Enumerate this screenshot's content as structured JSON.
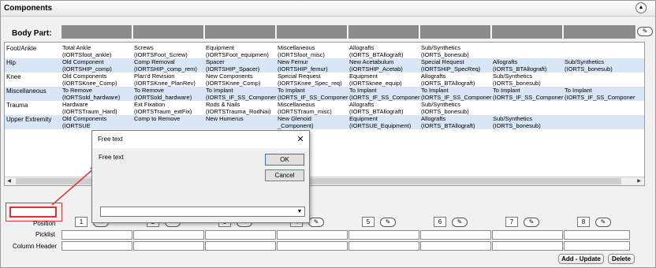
{
  "panel": {
    "title": "Components",
    "collapse_icon": "chevron-up-icon"
  },
  "body_part": {
    "label": "Body Part:",
    "edit_icon": "pencil-icon"
  },
  "grid": {
    "rows": [
      {
        "category": "Foot/Ankle",
        "cells": [
          {
            "name": "Total Ankle",
            "code": "(IORTSfoot_ankle)"
          },
          {
            "name": "Screws",
            "code": "(IORTSFoot_Screw)"
          },
          {
            "name": "Equipment",
            "code": "(IORTSFoot_equipmen)"
          },
          {
            "name": "Miscellaneous",
            "code": "(IORTSfoot_misc)"
          },
          {
            "name": "Allografts",
            "code": "(IORTS_BTAllograft)"
          },
          {
            "name": "Sub/Synthetics",
            "code": "(IORTS_bonesub)"
          },
          {
            "name": "",
            "code": ""
          },
          {
            "name": "",
            "code": ""
          }
        ]
      },
      {
        "category": "Hip",
        "cells": [
          {
            "name": "Old Component",
            "code": "(IORTSHIP_comp)"
          },
          {
            "name": "Comp Removal",
            "code": "(IORTSHIP_comp_rem)"
          },
          {
            "name": "Spacer",
            "code": "(IORTSHIP_Spacer)"
          },
          {
            "name": "New Femur",
            "code": "(IORTSHIP_femur)"
          },
          {
            "name": "New Acetabulum",
            "code": "(IORTSHIP_Acetab)"
          },
          {
            "name": "Special Request",
            "code": "(IORTSHIP_SpecReq)"
          },
          {
            "name": "Allografts",
            "code": "(IORTS_BTAllograft)"
          },
          {
            "name": "Sub/Synthetics",
            "code": "(IORTS_bonesub)"
          }
        ]
      },
      {
        "category": "Knee",
        "cells": [
          {
            "name": "Old Components",
            "code": "(IORTSKnee_Comp)"
          },
          {
            "name": "Plan'd Revision",
            "code": "(IORTSKnee_PlanRev)"
          },
          {
            "name": "New Components",
            "code": "(IORTSKnee_Comp)"
          },
          {
            "name": "Special Request",
            "code": "(IORTSKnee_Spec_req)"
          },
          {
            "name": "Equipment",
            "code": "(IORTSknee_equip)"
          },
          {
            "name": "Allografts",
            "code": "(IORTS_BTAllograft)"
          },
          {
            "name": "Sub/Synthetics",
            "code": "(IORTS_bonesub)"
          },
          {
            "name": "",
            "code": ""
          }
        ]
      },
      {
        "category": "Miscellaneous",
        "cells": [
          {
            "name": "To Remove",
            "code": "(IORTSold_hardware)"
          },
          {
            "name": "To Remove",
            "code": "(IORTSold_hardware)"
          },
          {
            "name": "To Implant",
            "code": "(IORTS_IF_SS_Componer"
          },
          {
            "name": "To Implant",
            "code": "(IORTS_IF_SS_Componer"
          },
          {
            "name": "To Implant",
            "code": "(IORTS_IF_SS_Componer"
          },
          {
            "name": "To Implant",
            "code": "(IORTS_IF_SS_Componer"
          },
          {
            "name": "To Implant",
            "code": "(IORTS_IF_SS_Componer"
          },
          {
            "name": "To Implant",
            "code": "(IORTS_IF_SS_Componer"
          }
        ]
      },
      {
        "category": "Trauma",
        "cells": [
          {
            "name": "Hardware",
            "code": "(IORTSTraum_Hard)"
          },
          {
            "name": "Ext Fixation",
            "code": "(IORTSTraum_extFix)"
          },
          {
            "name": "Rods & Nails",
            "code": "(IORTSTrauma_RodNai)"
          },
          {
            "name": "Miscellaneous",
            "code": "(IORTSTraum_misc)"
          },
          {
            "name": "Allografts",
            "code": "(IORTS_BTAllograft)"
          },
          {
            "name": "Sub/Synthetics",
            "code": "(IORTS_bonesub)"
          },
          {
            "name": "",
            "code": ""
          },
          {
            "name": "",
            "code": ""
          }
        ]
      },
      {
        "category": "Upper Extremity",
        "cells": [
          {
            "name": "Old Components",
            "code": "(IORTSUE"
          },
          {
            "name": "Comp to Remove",
            "code": ""
          },
          {
            "name": "New Humerus",
            "code": ""
          },
          {
            "name": "New Glenoid",
            "code": "_Component)"
          },
          {
            "name": "Equipment",
            "code": "(IORTSUE_Equipment)"
          },
          {
            "name": "Allografts",
            "code": "(IORTS_BTAllograft)"
          },
          {
            "name": "Sub/Synthetics",
            "code": "(IORTS_bonesub)"
          },
          {
            "name": "",
            "code": ""
          }
        ]
      }
    ]
  },
  "editor": {
    "position_label": "Position",
    "picklist_label": "Picklist",
    "column_header_label": "Column Header",
    "positions": [
      "1",
      "2",
      "3",
      "4",
      "5",
      "6",
      "7",
      "8"
    ],
    "add_update_label": "Add - Update",
    "delete_label": "Delete"
  },
  "dialog": {
    "title": "Free text",
    "prompt": "Free text",
    "ok_label": "OK",
    "cancel_label": "Cancel",
    "combo_value": "",
    "close_icon": "close-icon"
  },
  "colors": {
    "accent_red": "#dd3333",
    "header_gray": "#8c8c8c"
  }
}
